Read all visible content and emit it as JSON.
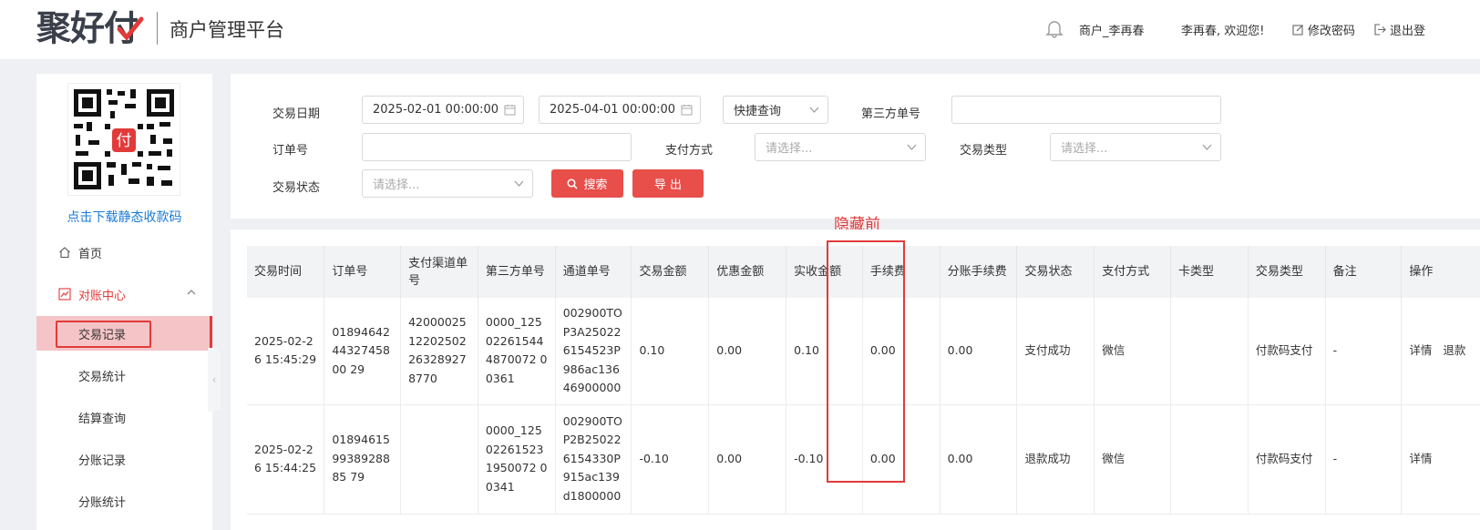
{
  "header": {
    "logo_text": "聚好付",
    "platform_title": "商户管理平台",
    "merchant": "商户_李再春",
    "welcome": "李再春, 欢迎您!",
    "change_password": "修改密码",
    "logout": "退出登"
  },
  "sidebar": {
    "qr_badge": "付",
    "qr_download": "点击下载静态收款码",
    "home": "首页",
    "reconciliation": "对账中心",
    "sub_items": [
      "交易记录",
      "交易统计",
      "结算查询",
      "分账记录",
      "分账统计"
    ]
  },
  "filter": {
    "date_label": "交易日期",
    "start_date": "2025-02-01 00:00:00",
    "end_date": "2025-04-01 00:00:00",
    "quick_query": "快捷查询",
    "third_party_label": "第三方单号",
    "order_label": "订单号",
    "pay_method_label": "支付方式",
    "pay_method_placeholder": "请选择...",
    "trade_type_label": "交易类型",
    "trade_type_placeholder": "请选择...",
    "trade_status_label": "交易状态",
    "trade_status_placeholder": "请选择...",
    "search_button": "搜索",
    "export_button": "导 出"
  },
  "annotation": "隐藏前",
  "table": {
    "headers": [
      "交易时间",
      "订单号",
      "支付渠道单号",
      "第三方单号",
      "通道单号",
      "交易金额",
      "优惠金额",
      "实收金额",
      "手续费",
      "分账手续费",
      "交易状态",
      "支付方式",
      "卡类型",
      "交易类型",
      "备注",
      "操作"
    ],
    "rows": [
      {
        "time": "2025-02-26 15:45:29",
        "order": "018946424432745800 29",
        "channel": "420000251220250226328927 8770",
        "third": "0000_125022615444870072 00361",
        "passage": "002900TOP3A250226154523P986ac13646900000",
        "amount": "0.10",
        "discount": "0.00",
        "received": "0.10",
        "fee": "0.00",
        "split_fee": "0.00",
        "status": "支付成功",
        "method": "微信",
        "card": "",
        "type": "付款码支付",
        "remark": "-",
        "ops": [
          "详情",
          "退款"
        ]
      },
      {
        "time": "2025-02-26 15:44:25",
        "order": "018946159938928885 79",
        "channel": "",
        "third": "0000_125022615231950072 00341",
        "passage": "002900TOP2B250226154330P915ac139d1800000",
        "amount": "-0.10",
        "discount": "0.00",
        "received": "-0.10",
        "fee": "0.00",
        "split_fee": "0.00",
        "status": "退款成功",
        "method": "微信",
        "card": "",
        "type": "付款码支付",
        "remark": "-",
        "ops": [
          "详情"
        ]
      }
    ]
  }
}
